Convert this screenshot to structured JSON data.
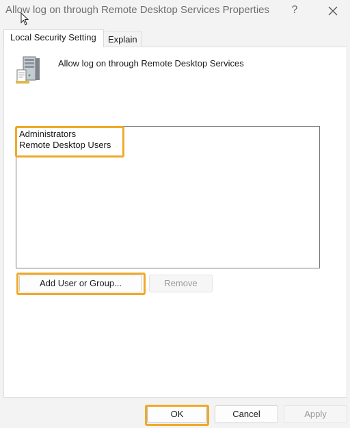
{
  "window": {
    "title": "Allow log on through Remote Desktop Services Properties",
    "help_label": "?",
    "icons": [
      "help-icon",
      "close-icon",
      "mouse-cursor-icon"
    ]
  },
  "tabs": [
    {
      "label": "Local Security Setting",
      "active": true
    },
    {
      "label": "Explain",
      "active": false
    }
  ],
  "policy": {
    "icon": "server-icon",
    "title": "Allow log on through Remote Desktop Services"
  },
  "members": [
    "Administrators",
    "Remote Desktop Users"
  ],
  "actions": {
    "add_label": "Add User or Group...",
    "remove_label": "Remove"
  },
  "footer": {
    "ok_label": "OK",
    "cancel_label": "Cancel",
    "apply_label": "Apply"
  },
  "colors": {
    "highlight": "#f0a927",
    "background": "#f3f3f3",
    "panel": "#ffffff"
  }
}
